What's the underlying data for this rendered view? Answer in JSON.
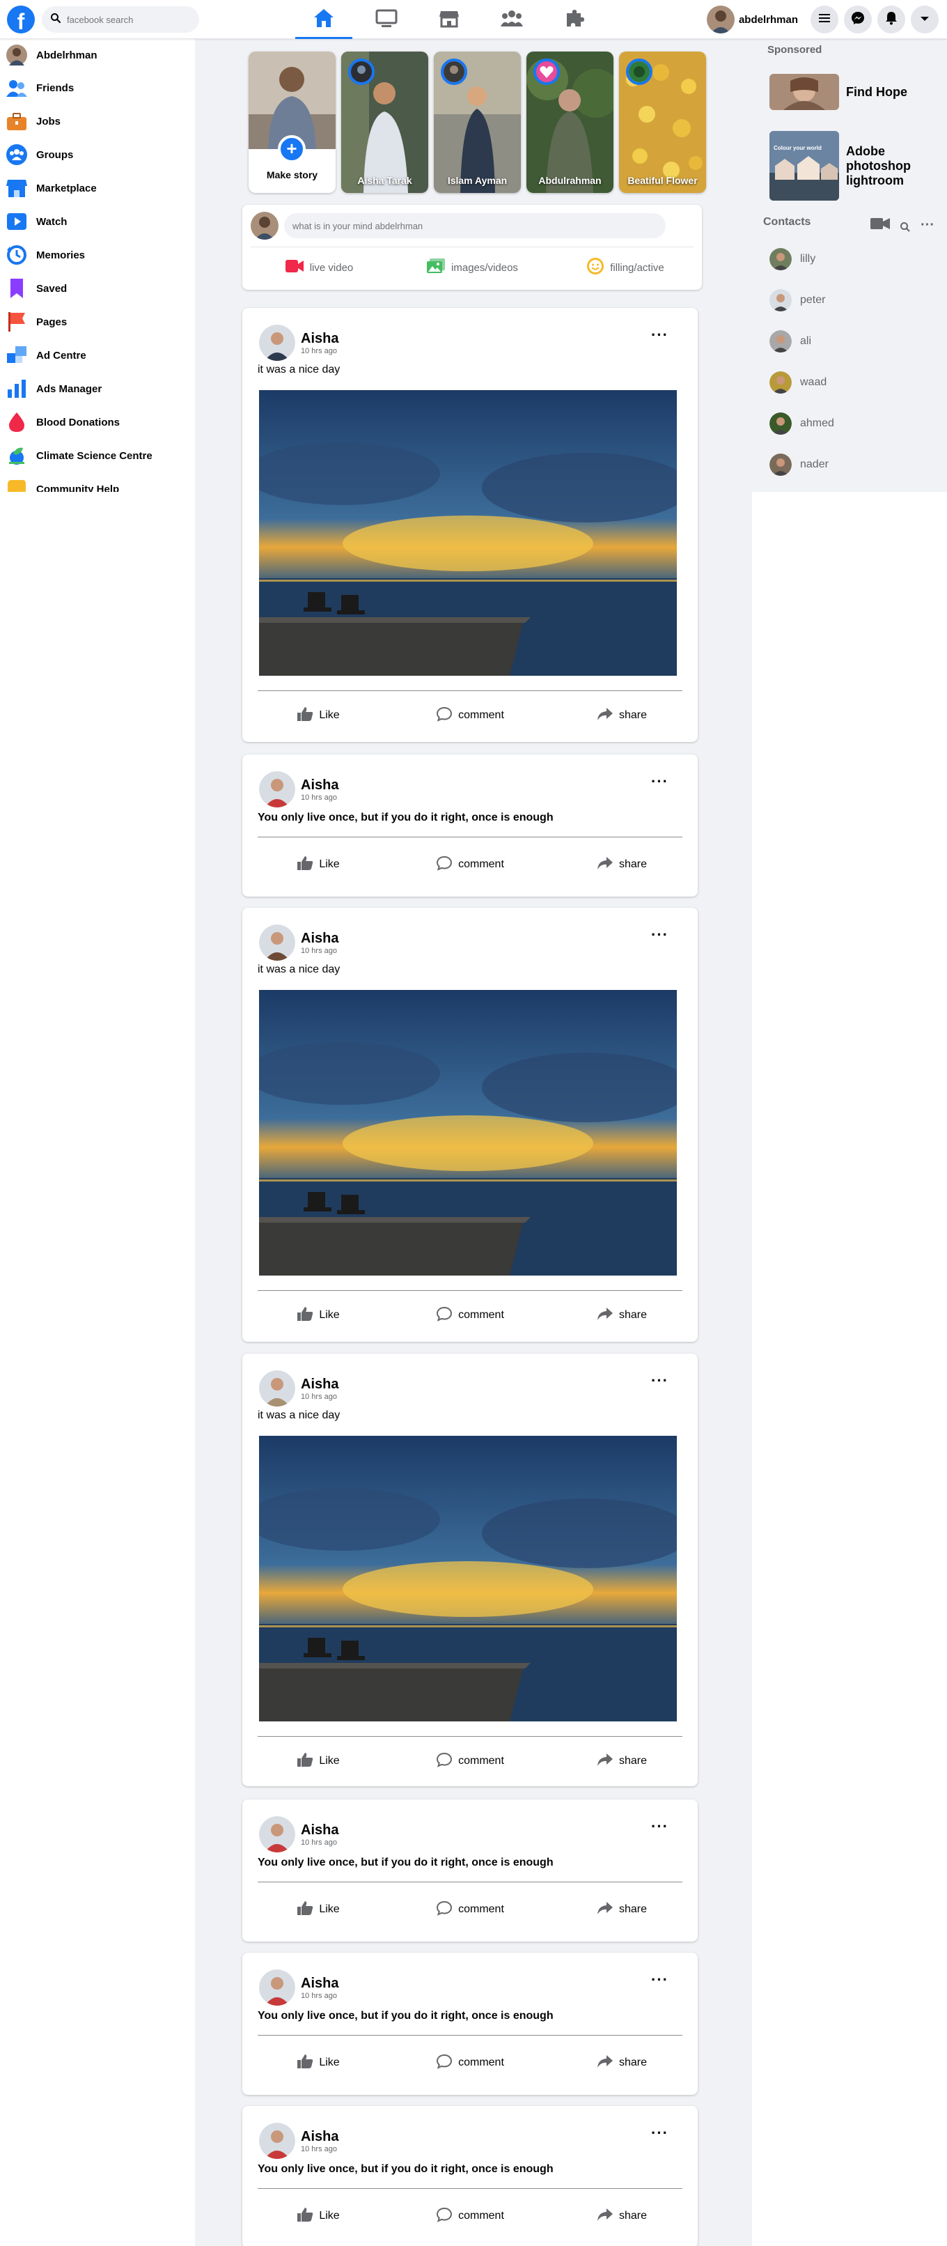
{
  "header": {
    "logo": "f",
    "search_placeholder": "facebook search",
    "nav_tabs": [
      {
        "name": "home-icon",
        "active": true
      },
      {
        "name": "watch-icon",
        "active": false
      },
      {
        "name": "marketplace-icon",
        "active": false
      },
      {
        "name": "groups-icon",
        "active": false
      },
      {
        "name": "gaming-icon",
        "active": false
      }
    ],
    "profile_name": "abdelrhman",
    "right_buttons": [
      "menu-icon",
      "messenger-icon",
      "bell-icon",
      "chevron-down-icon"
    ]
  },
  "sidebar": {
    "items": [
      {
        "label": "Abdelrhman",
        "icon": "profile-avatar"
      },
      {
        "label": "Friends",
        "icon": "friends-icon",
        "color": "#1877f2"
      },
      {
        "label": "Jobs",
        "icon": "jobs-icon",
        "color": "#e8832a"
      },
      {
        "label": "Groups",
        "icon": "groups-icon",
        "color": "#1877f2"
      },
      {
        "label": "Marketplace",
        "icon": "marketplace-icon",
        "color": "#1877f2"
      },
      {
        "label": "Watch",
        "icon": "watch-icon",
        "color": "#1877f2"
      },
      {
        "label": "Memories",
        "icon": "memories-icon",
        "color": "#1877f2"
      },
      {
        "label": "Saved",
        "icon": "saved-icon",
        "color": "#8b3dff"
      },
      {
        "label": "Pages",
        "icon": "pages-icon",
        "color": "#f5533d"
      },
      {
        "label": "Ad Centre",
        "icon": "ad-centre-icon",
        "color": "#1877f2"
      },
      {
        "label": "Ads Manager",
        "icon": "ads-manager-icon",
        "color": "#1877f2"
      },
      {
        "label": "Blood Donations",
        "icon": "blood-drop-icon",
        "color": "#f02849"
      },
      {
        "label": "Climate Science Centre",
        "icon": "climate-icon",
        "color": "#45bd62"
      },
      {
        "label": "Community Help",
        "icon": "community-help-icon",
        "color": "#f7b928"
      }
    ]
  },
  "stories": {
    "make_story_label": "Make story",
    "items": [
      {
        "name": "Aisha Tarak"
      },
      {
        "name": "Islam Ayman"
      },
      {
        "name": "Abdulrahman"
      },
      {
        "name": "Beatiful Flower"
      }
    ]
  },
  "composer": {
    "placeholder": "what is in your mind abdelrhman",
    "actions": [
      {
        "label": "live video",
        "icon": "live-video-icon",
        "color": "#f02849"
      },
      {
        "label": "images/videos",
        "icon": "photo-icon",
        "color": "#45bd62"
      },
      {
        "label": "filling/active",
        "icon": "feeling-icon",
        "color": "#f7b928"
      }
    ]
  },
  "post_actions": {
    "like": "Like",
    "comment": "comment",
    "share": "share"
  },
  "posts": [
    {
      "author": "Aisha",
      "time": "10 hrs ago",
      "text": "it was a nice day",
      "has_image": true
    },
    {
      "author": "Aisha",
      "time": "10 hrs ago",
      "text": "You only live once, but if you do it right, once is enough",
      "has_image": false
    },
    {
      "author": "Aisha",
      "time": "10 hrs ago",
      "text": "it was a nice day",
      "has_image": true
    },
    {
      "author": "Aisha",
      "time": "10 hrs ago",
      "text": "it was a nice day",
      "has_image": true
    },
    {
      "author": "Aisha",
      "time": "10 hrs ago",
      "text": "You only live once, but if you do it right, once is enough",
      "has_image": false
    },
    {
      "author": "Aisha",
      "time": "10 hrs ago",
      "text": "You only live once, but if you do it right, once is enough",
      "has_image": false
    },
    {
      "author": "Aisha",
      "time": "10 hrs ago",
      "text": "You only live once, but if you do it right, once is enough",
      "has_image": false
    }
  ],
  "right_sidebar": {
    "sponsored_title": "Sponsored",
    "ads": [
      {
        "name": "Find Hope"
      },
      {
        "name": "Adobe photoshop lightroom",
        "image_text": "Colour your world"
      }
    ],
    "contacts_title": "Contacts",
    "contacts": [
      "lilly",
      "peter",
      "ali",
      "waad",
      "ahmed",
      "nader"
    ]
  }
}
